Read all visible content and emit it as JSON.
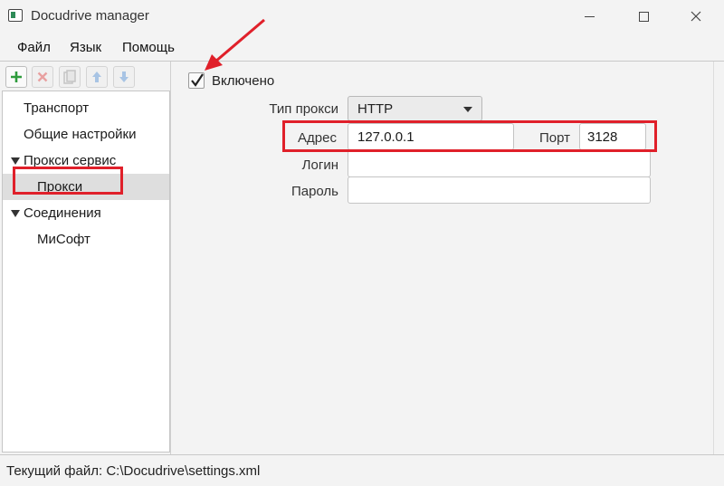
{
  "window": {
    "title": "Docudrive manager"
  },
  "menu": {
    "file": "Файл",
    "language": "Язык",
    "help": "Помощь"
  },
  "toolbar": {
    "icons": [
      "plus-icon",
      "delete-x-icon",
      "copy-icon",
      "arrow-up-icon",
      "arrow-down-icon"
    ]
  },
  "tree": {
    "items": [
      {
        "label": "Транспорт"
      },
      {
        "label": "Общие настройки"
      },
      {
        "label": "Прокси сервис",
        "expanded": true
      },
      {
        "label": "Прокси",
        "selected": true
      },
      {
        "label": "Соединения",
        "expanded": true
      },
      {
        "label": "МиСофт"
      }
    ]
  },
  "form": {
    "enabled_label": "Включено",
    "enabled_checked": true,
    "proxy_type_label": "Тип прокси",
    "proxy_type_value": "HTTP",
    "address_label": "Адрес",
    "address_value": "127.0.0.1",
    "port_label": "Порт",
    "port_value": "3128",
    "login_label": "Логин",
    "login_value": "",
    "password_label": "Пароль",
    "password_value": ""
  },
  "status": {
    "label": "Текущий файл:",
    "path": "C:\\Docudrive\\settings.xml"
  },
  "colors": {
    "highlight": "#e0202a",
    "add_icon": "#2e9b3c",
    "selected_row": "#dedede"
  }
}
